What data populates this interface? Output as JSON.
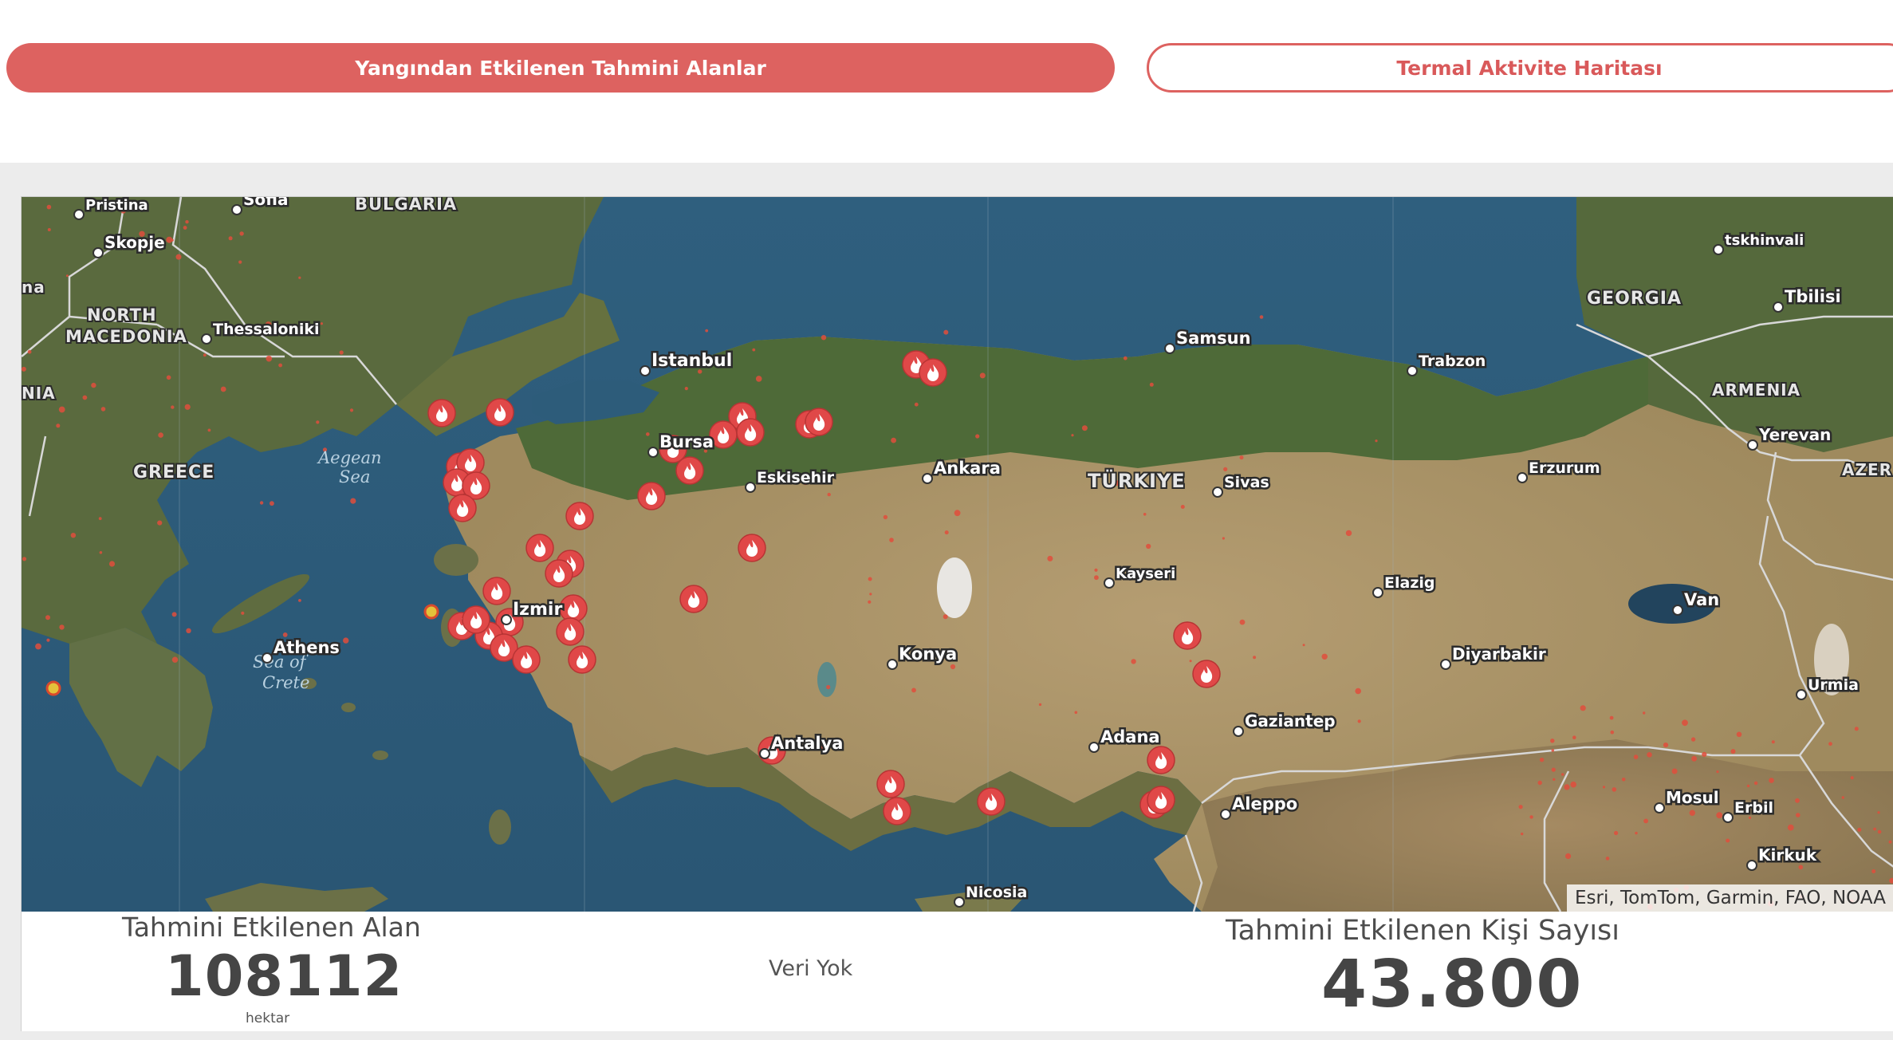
{
  "tabs": [
    {
      "label": "Yangından Etkilenen Tahmini Alanlar",
      "active": true
    },
    {
      "label": "Termal Aktivite Haritası",
      "active": false
    }
  ],
  "map": {
    "attribution": "Esri, TomTom, Garmin, FAO, NOAA",
    "cities": [
      {
        "name": "Pristina"
      },
      {
        "name": "Sofia"
      },
      {
        "name": "Skopje"
      },
      {
        "name": "Thessaloniki"
      },
      {
        "name": "Athens"
      },
      {
        "name": "Istanbul"
      },
      {
        "name": "Bursa"
      },
      {
        "name": "Eskisehir"
      },
      {
        "name": "Ankara"
      },
      {
        "name": "Samsun"
      },
      {
        "name": "Trabzon"
      },
      {
        "name": "Sivas"
      },
      {
        "name": "Erzurum"
      },
      {
        "name": "Tbilisi"
      },
      {
        "name": "Yerevan"
      },
      {
        "name": "tskhinvali"
      },
      {
        "name": "Izmir"
      },
      {
        "name": "Kayseri"
      },
      {
        "name": "Konya"
      },
      {
        "name": "Antalya"
      },
      {
        "name": "Adana"
      },
      {
        "name": "Gaziantep"
      },
      {
        "name": "Aleppo"
      },
      {
        "name": "Elazig"
      },
      {
        "name": "Diyarbakir"
      },
      {
        "name": "Van"
      },
      {
        "name": "Urmia"
      },
      {
        "name": "Mosul"
      },
      {
        "name": "Erbil"
      },
      {
        "name": "Kirkuk"
      },
      {
        "name": "Nicosia"
      }
    ],
    "countries": [
      "BULGARIA",
      "NORTH",
      "MACEDONIA",
      "GREECE",
      "TÜRKIYE",
      "GEORGIA",
      "ARMENIA",
      "AZER",
      "NIA",
      "na"
    ],
    "seas": [
      "Aegean",
      "Sea",
      "Sea of",
      "Crete"
    ],
    "fire_marker_icon": "fire-icon",
    "fire_marker_color": "#e04848",
    "fire_marker_count": 42
  },
  "stats": {
    "area_title": "Tahmini Etkilenen Alan",
    "area_value": "108112",
    "area_unit": "hektar",
    "middle_text": "Veri Yok",
    "people_title": "Tahmini Etkilenen Kişi Sayısı",
    "people_value": "43.800"
  }
}
